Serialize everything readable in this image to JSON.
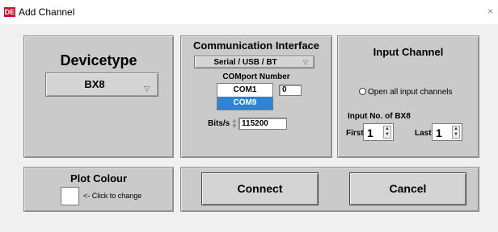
{
  "window": {
    "icon_text": "DE",
    "title": "Add Channel",
    "close_glyph": "×"
  },
  "device_panel": {
    "title": "Devicetype",
    "selected_device": "BX8",
    "arrow_glyph": "▽"
  },
  "comm_panel": {
    "title": "Communication Interface",
    "interface_value": "Serial / USB / BT",
    "arrow_glyph": "▽",
    "comport_label": "COMport Number",
    "comport_options": [
      "COM1",
      "COM9"
    ],
    "comport_highlighted": "COM9",
    "port_number_value": "0",
    "bits_label": "Bits/s",
    "bits_value": "115200"
  },
  "input_panel": {
    "title": "Input Channel",
    "open_all_label": "Open all input channels",
    "open_all_checked": false,
    "input_no_label": "Input No. of BX8",
    "first_label": "First",
    "first_value": "1",
    "last_label": "Last",
    "last_value": "1"
  },
  "plot_panel": {
    "title": "Plot Colour",
    "hint": "<- Click to change",
    "swatch_color": "#ffffff"
  },
  "buttons": {
    "connect_label": "Connect",
    "cancel_label": "Cancel"
  },
  "colors": {
    "highlight": "#2f83d5",
    "panel_bg": "#cacaca",
    "window_bg": "#f0f0f0",
    "icon_red": "#c8102e"
  }
}
